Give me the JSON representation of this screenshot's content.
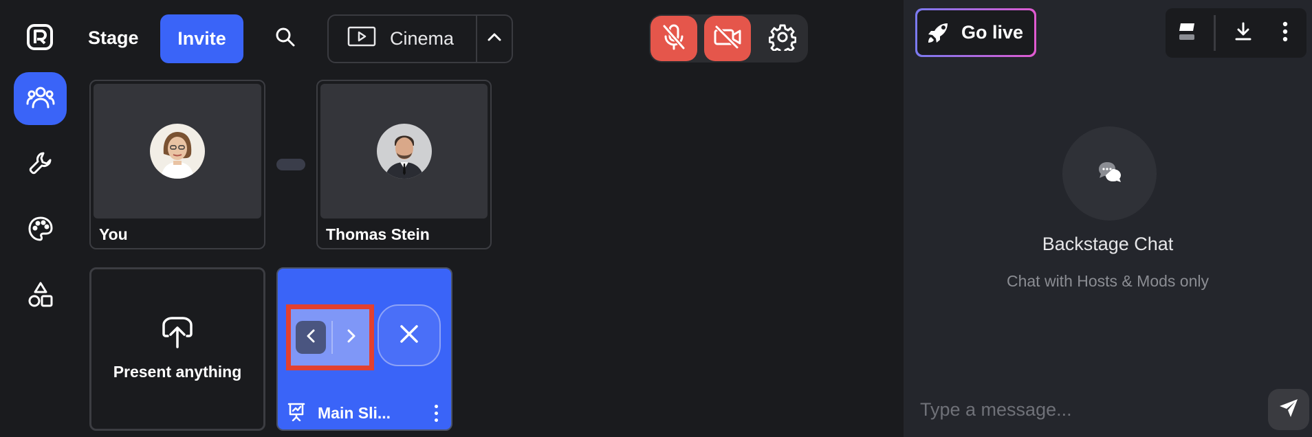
{
  "app": {
    "logo_icon": "r-logo-icon"
  },
  "rail": {
    "items": [
      {
        "name": "people-icon",
        "active": true
      },
      {
        "name": "wrench-icon",
        "active": false
      },
      {
        "name": "palette-icon",
        "active": false
      },
      {
        "name": "shapes-icon",
        "active": false
      }
    ]
  },
  "topbar": {
    "stage_label": "Stage",
    "invite_label": "Invite",
    "layout_label": "Cinema"
  },
  "tiles": {
    "participants": [
      {
        "name": "You"
      },
      {
        "name": "Thomas Stein"
      }
    ],
    "present_label": "Present anything",
    "slides_label": "Main Sli..."
  },
  "right": {
    "go_live_label": "Go live",
    "chat_title": "Backstage Chat",
    "chat_subtitle": "Chat with Hosts & Mods only",
    "message_placeholder": "Type a message..."
  },
  "colors": {
    "accent": "#3a64f8",
    "danger": "#e5564b",
    "background": "#1a1b1e",
    "panel": "#24262c"
  }
}
